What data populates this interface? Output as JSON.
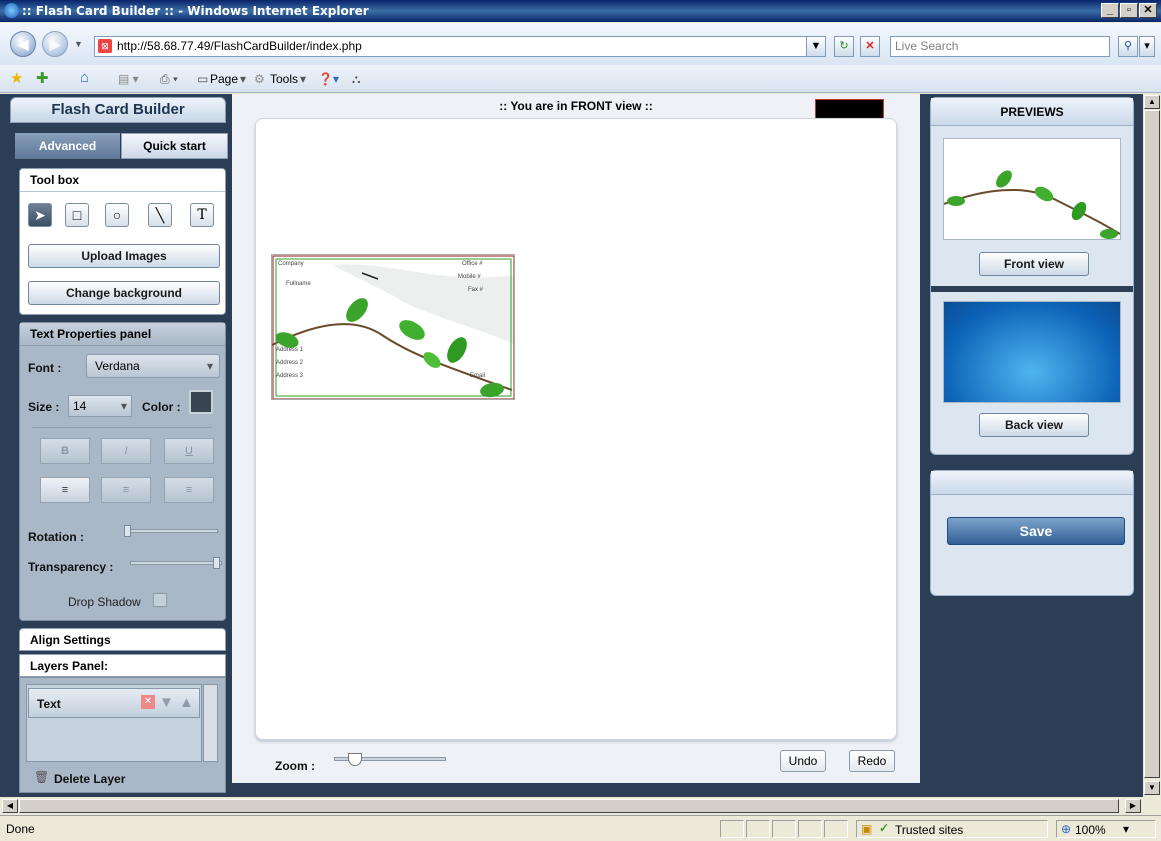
{
  "window": {
    "title": ":: Flash Card Builder :: - Windows Internet Explorer"
  },
  "browser": {
    "url": "http://58.68.77.49/FlashCardBuilder/index.php",
    "search_placeholder": "Live Search",
    "menu": {
      "page": "Page",
      "tools": "Tools"
    }
  },
  "app": {
    "title": "Flash Card Builder",
    "tabs": {
      "advanced": "Advanced",
      "quick_start": "Quick start"
    },
    "toolbox": {
      "title": "Tool box",
      "upload": "Upload Images",
      "change_bg": "Change background"
    },
    "text_props": {
      "title": "Text Properties panel",
      "font_label": "Font :",
      "font_value": "Verdana",
      "size_label": "Size :",
      "size_value": "14",
      "color_label": "Color :",
      "bold": "B",
      "italic": "I",
      "underline": "U",
      "rotation_label": "Rotation :",
      "transparency_label": "Transparency :",
      "drop_shadow_label": "Drop Shadow"
    },
    "align": {
      "title": "Align Settings"
    },
    "layers": {
      "title": "Layers Panel:",
      "item": "Text",
      "delete": "Delete Layer"
    },
    "stage": {
      "header": ":: You are in FRONT view ::",
      "zoom_label": "Zoom :",
      "undo": "Undo",
      "redo": "Redo"
    },
    "card": {
      "company": "Company",
      "fullname": "Fullname",
      "office": "Office #",
      "mobile": "Mobile #",
      "fax": "Fax #",
      "address1": "Address 1",
      "address2": "Address 2",
      "address3": "Address 3",
      "email": "Email"
    },
    "previews": {
      "title": "PREVIEWS",
      "front": "Front view",
      "back": "Back view",
      "save": "Save"
    }
  },
  "status": {
    "left": "Done",
    "zone": "Trusted sites",
    "zoom": "100%"
  }
}
